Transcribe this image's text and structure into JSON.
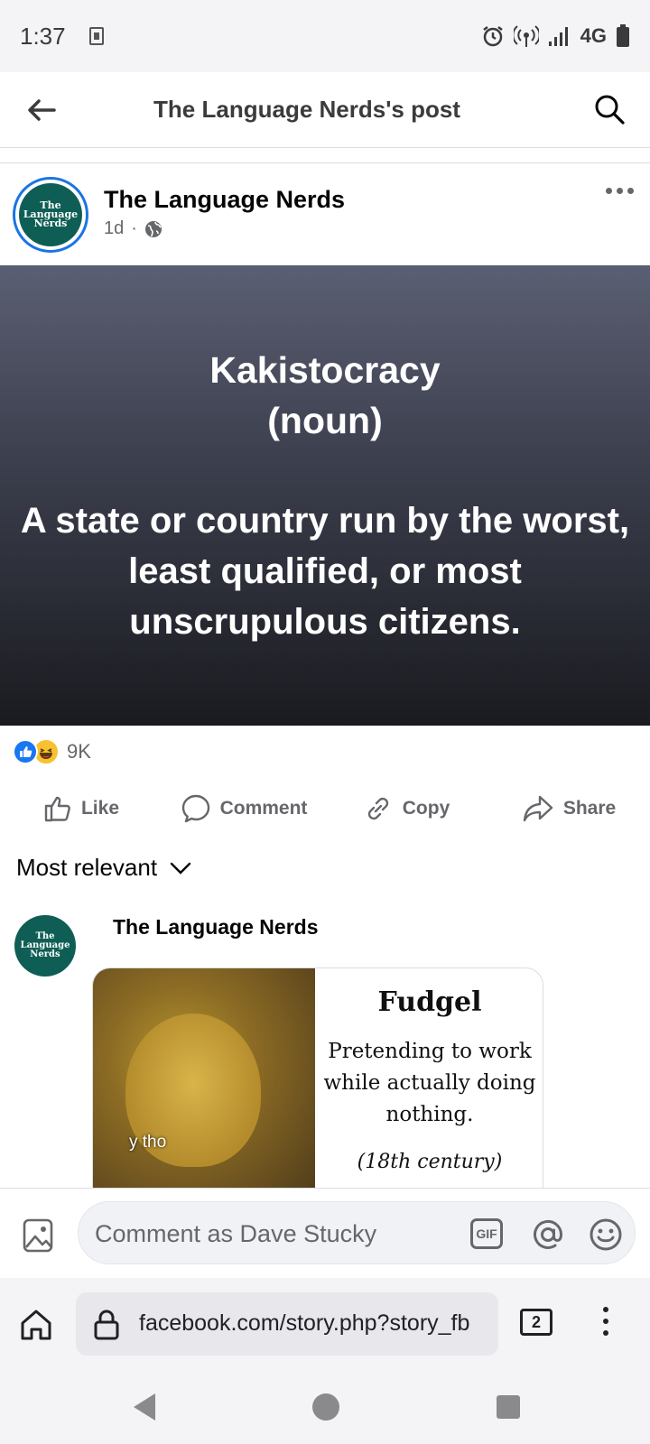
{
  "status_bar": {
    "time": "1:37",
    "network": "4G"
  },
  "header": {
    "title": "The Language Nerds's post"
  },
  "post": {
    "author": "The Language Nerds",
    "avatar_text": [
      "The",
      "Language",
      "Nerds"
    ],
    "age": "1d",
    "separator": "·",
    "card": {
      "word": "Kakistocracy",
      "part_of_speech": "(noun)",
      "definition": "A state or country run by the worst, least qualified, or most unscrupulous citizens.",
      "text_color": "#ffffff"
    },
    "reactions": {
      "count": "9K",
      "types": [
        "like",
        "haha"
      ]
    }
  },
  "actions": {
    "like": "Like",
    "comment": "Comment",
    "copy": "Copy",
    "share": "Share"
  },
  "comments_section": {
    "sort_label": "Most relevant",
    "comments": [
      {
        "author": "The Language Nerds",
        "avatar_text": [
          "The",
          "Language",
          "Nerds"
        ],
        "image": {
          "meme_caption": "y tho",
          "word": "Fudgel",
          "definition": "Pretending to work while actually doing nothing.",
          "era": "(18th century)"
        }
      }
    ]
  },
  "composer": {
    "placeholder": "Comment as Dave Stucky",
    "gif_label": "GIF"
  },
  "browser": {
    "url": "facebook.com/story.php?story_fb",
    "tab_count": "2"
  },
  "colors": {
    "brand_blue": "#1877f2",
    "avatar_green": "#0f5e55",
    "secondary_text": "#65676b"
  }
}
